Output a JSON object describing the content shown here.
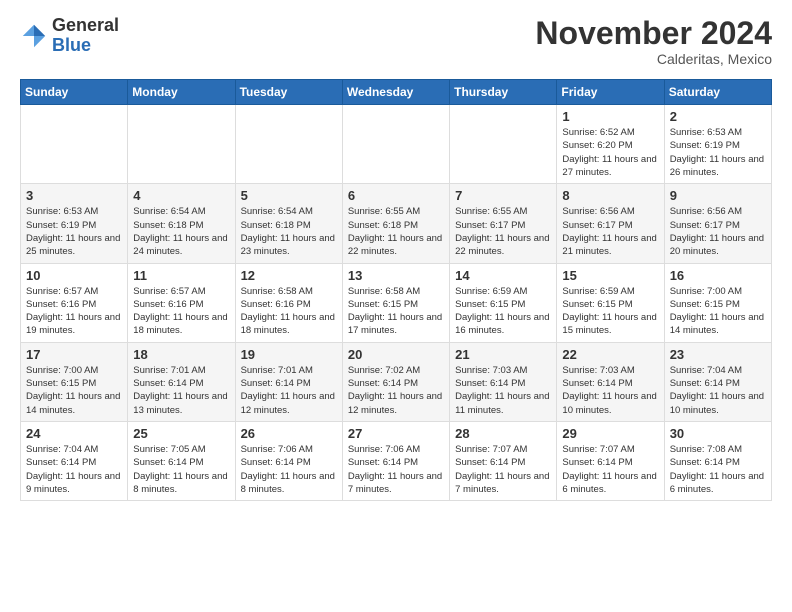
{
  "logo": {
    "general": "General",
    "blue": "Blue"
  },
  "title": "November 2024",
  "location": "Calderitas, Mexico",
  "days_of_week": [
    "Sunday",
    "Monday",
    "Tuesday",
    "Wednesday",
    "Thursday",
    "Friday",
    "Saturday"
  ],
  "weeks": [
    [
      {
        "day": "",
        "info": ""
      },
      {
        "day": "",
        "info": ""
      },
      {
        "day": "",
        "info": ""
      },
      {
        "day": "",
        "info": ""
      },
      {
        "day": "",
        "info": ""
      },
      {
        "day": "1",
        "info": "Sunrise: 6:52 AM\nSunset: 6:20 PM\nDaylight: 11 hours and 27 minutes."
      },
      {
        "day": "2",
        "info": "Sunrise: 6:53 AM\nSunset: 6:19 PM\nDaylight: 11 hours and 26 minutes."
      }
    ],
    [
      {
        "day": "3",
        "info": "Sunrise: 6:53 AM\nSunset: 6:19 PM\nDaylight: 11 hours and 25 minutes."
      },
      {
        "day": "4",
        "info": "Sunrise: 6:54 AM\nSunset: 6:18 PM\nDaylight: 11 hours and 24 minutes."
      },
      {
        "day": "5",
        "info": "Sunrise: 6:54 AM\nSunset: 6:18 PM\nDaylight: 11 hours and 23 minutes."
      },
      {
        "day": "6",
        "info": "Sunrise: 6:55 AM\nSunset: 6:18 PM\nDaylight: 11 hours and 22 minutes."
      },
      {
        "day": "7",
        "info": "Sunrise: 6:55 AM\nSunset: 6:17 PM\nDaylight: 11 hours and 22 minutes."
      },
      {
        "day": "8",
        "info": "Sunrise: 6:56 AM\nSunset: 6:17 PM\nDaylight: 11 hours and 21 minutes."
      },
      {
        "day": "9",
        "info": "Sunrise: 6:56 AM\nSunset: 6:17 PM\nDaylight: 11 hours and 20 minutes."
      }
    ],
    [
      {
        "day": "10",
        "info": "Sunrise: 6:57 AM\nSunset: 6:16 PM\nDaylight: 11 hours and 19 minutes."
      },
      {
        "day": "11",
        "info": "Sunrise: 6:57 AM\nSunset: 6:16 PM\nDaylight: 11 hours and 18 minutes."
      },
      {
        "day": "12",
        "info": "Sunrise: 6:58 AM\nSunset: 6:16 PM\nDaylight: 11 hours and 18 minutes."
      },
      {
        "day": "13",
        "info": "Sunrise: 6:58 AM\nSunset: 6:15 PM\nDaylight: 11 hours and 17 minutes."
      },
      {
        "day": "14",
        "info": "Sunrise: 6:59 AM\nSunset: 6:15 PM\nDaylight: 11 hours and 16 minutes."
      },
      {
        "day": "15",
        "info": "Sunrise: 6:59 AM\nSunset: 6:15 PM\nDaylight: 11 hours and 15 minutes."
      },
      {
        "day": "16",
        "info": "Sunrise: 7:00 AM\nSunset: 6:15 PM\nDaylight: 11 hours and 14 minutes."
      }
    ],
    [
      {
        "day": "17",
        "info": "Sunrise: 7:00 AM\nSunset: 6:15 PM\nDaylight: 11 hours and 14 minutes."
      },
      {
        "day": "18",
        "info": "Sunrise: 7:01 AM\nSunset: 6:14 PM\nDaylight: 11 hours and 13 minutes."
      },
      {
        "day": "19",
        "info": "Sunrise: 7:01 AM\nSunset: 6:14 PM\nDaylight: 11 hours and 12 minutes."
      },
      {
        "day": "20",
        "info": "Sunrise: 7:02 AM\nSunset: 6:14 PM\nDaylight: 11 hours and 12 minutes."
      },
      {
        "day": "21",
        "info": "Sunrise: 7:03 AM\nSunset: 6:14 PM\nDaylight: 11 hours and 11 minutes."
      },
      {
        "day": "22",
        "info": "Sunrise: 7:03 AM\nSunset: 6:14 PM\nDaylight: 11 hours and 10 minutes."
      },
      {
        "day": "23",
        "info": "Sunrise: 7:04 AM\nSunset: 6:14 PM\nDaylight: 11 hours and 10 minutes."
      }
    ],
    [
      {
        "day": "24",
        "info": "Sunrise: 7:04 AM\nSunset: 6:14 PM\nDaylight: 11 hours and 9 minutes."
      },
      {
        "day": "25",
        "info": "Sunrise: 7:05 AM\nSunset: 6:14 PM\nDaylight: 11 hours and 8 minutes."
      },
      {
        "day": "26",
        "info": "Sunrise: 7:06 AM\nSunset: 6:14 PM\nDaylight: 11 hours and 8 minutes."
      },
      {
        "day": "27",
        "info": "Sunrise: 7:06 AM\nSunset: 6:14 PM\nDaylight: 11 hours and 7 minutes."
      },
      {
        "day": "28",
        "info": "Sunrise: 7:07 AM\nSunset: 6:14 PM\nDaylight: 11 hours and 7 minutes."
      },
      {
        "day": "29",
        "info": "Sunrise: 7:07 AM\nSunset: 6:14 PM\nDaylight: 11 hours and 6 minutes."
      },
      {
        "day": "30",
        "info": "Sunrise: 7:08 AM\nSunset: 6:14 PM\nDaylight: 11 hours and 6 minutes."
      }
    ]
  ]
}
